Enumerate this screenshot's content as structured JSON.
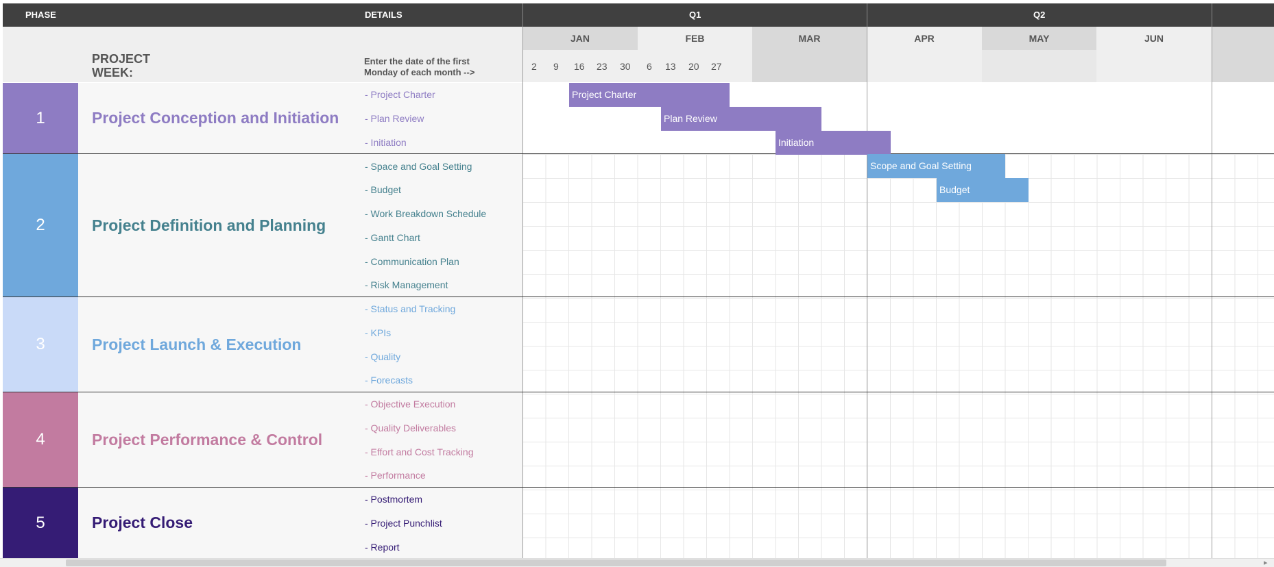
{
  "header": {
    "phase": "PHASE",
    "details": "DETAILS",
    "quarters": [
      "Q1",
      "Q2"
    ]
  },
  "subheader": {
    "project_week": "PROJECT WEEK:",
    "instruction": "Enter the date of the first Monday of each month -->",
    "months": [
      "JAN",
      "FEB",
      "MAR",
      "APR",
      "MAY",
      "JUN"
    ],
    "weeks": [
      "2",
      "9",
      "16",
      "23",
      "30",
      "6",
      "13",
      "20",
      "27"
    ]
  },
  "phases": [
    {
      "number": "1",
      "title": "Project Conception and Initiation",
      "color": "#8e7cc3",
      "text_color": "#8e7cc3",
      "details": [
        "- Project Charter",
        "- Plan Review",
        "- Initiation"
      ]
    },
    {
      "number": "2",
      "title": "Project Definition and Planning",
      "color": "#6fa8dc",
      "text_color": "#45818e",
      "details": [
        "- Space and Goal Setting",
        "- Budget",
        "- Work Breakdown Schedule",
        "- Gantt Chart",
        "- Communication Plan",
        "- Risk Management"
      ]
    },
    {
      "number": "3",
      "title": "Project Launch & Execution",
      "color": "#c9daf8",
      "text_color": "#6fa8dc",
      "details": [
        "- Status and Tracking",
        "- KPIs",
        "- Quality",
        "- Forecasts"
      ]
    },
    {
      "number": "4",
      "title": "Project Performance & Control",
      "color": "#c27ba0",
      "text_color": "#c27ba0",
      "details": [
        "- Objective Execution",
        "- Quality Deliverables",
        "- Effort and Cost Tracking",
        "- Performance"
      ]
    },
    {
      "number": "5",
      "title": "Project Close",
      "color": "#351c75",
      "text_color": "#351c75",
      "details": [
        "- Postmortem",
        "- Project Punchlist",
        "- Report"
      ]
    }
  ],
  "bars": [
    {
      "label": "Project Charter",
      "color": "#8e7cc3"
    },
    {
      "label": "Plan Review",
      "color": "#8e7cc3"
    },
    {
      "label": "Initiation",
      "color": "#8e7cc3"
    },
    {
      "label": "Scope and Goal Setting",
      "color": "#6fa8dc"
    },
    {
      "label": "Budget",
      "color": "#6fa8dc"
    }
  ]
}
